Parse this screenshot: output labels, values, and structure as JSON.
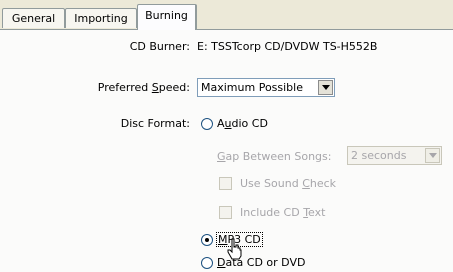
{
  "tabs": [
    {
      "label": "General"
    },
    {
      "label": "Importing"
    },
    {
      "label": "Burning"
    }
  ],
  "cd_burner": {
    "label": "CD Burner:",
    "value": "E: TSSTcorp CD/DVDW TS-H552B"
  },
  "preferred_speed": {
    "label_prefix": "Preferred ",
    "label_accel": "S",
    "label_suffix": "peed:",
    "value": "Maximum Possible"
  },
  "disc_format": {
    "label": "Disc Format:",
    "audio_cd": {
      "prefix": "A",
      "accel": "u",
      "suffix": "dio CD"
    },
    "gap": {
      "prefix": "",
      "accel": "G",
      "suffix": "ap Between Songs:",
      "value": "2 seconds"
    },
    "sound_check": {
      "prefix": "Use Sound ",
      "accel": "C",
      "suffix": "heck"
    },
    "cd_text": {
      "prefix": "Include CD ",
      "accel": "T",
      "suffix": "ext"
    },
    "mp3_cd": {
      "prefix": "",
      "accel": "M",
      "suffix": "P3 CD"
    },
    "data_cd": {
      "prefix": "",
      "accel": "D",
      "suffix": "ata CD or DVD"
    }
  },
  "selected_format": "mp3_cd"
}
